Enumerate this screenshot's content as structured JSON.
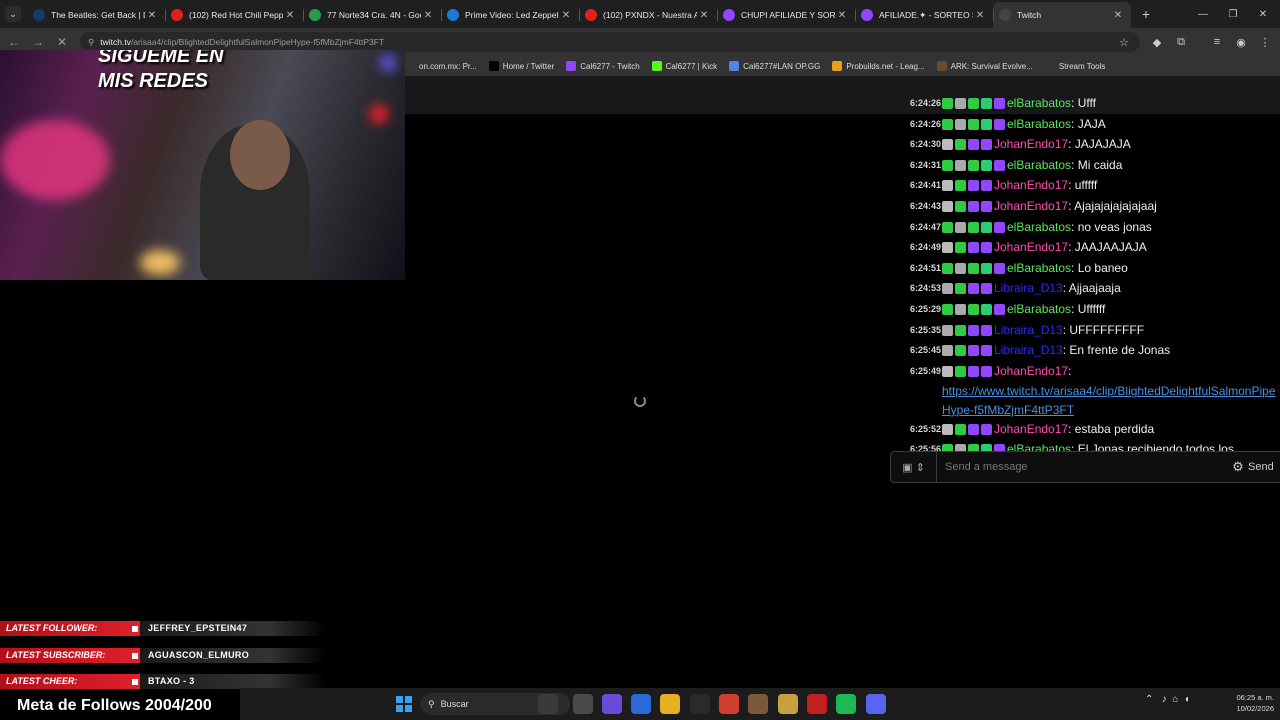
{
  "browser": {
    "tabs": [
      {
        "title": "The Beatles: Get Back | Di",
        "icon": "disney-icon",
        "color": "#1a3a6a"
      },
      {
        "title": "(102) Red Hot Chili Peppe",
        "icon": "youtube-icon",
        "color": "#e02020"
      },
      {
        "title": "77 Norte34 Cra. 4N - Goo",
        "icon": "maps-pin-icon",
        "color": "#2a9a4a"
      },
      {
        "title": "Prime Video: Led Zeppelin",
        "icon": "prime-video-icon",
        "color": "#1a7ad8"
      },
      {
        "title": "(102) PXNDX - Nuestra Af",
        "icon": "youtube-icon",
        "color": "#e02020"
      },
      {
        "title": "CHUPI AFILIADE Y SORTE",
        "icon": "twitch-icon",
        "color": "#9146ff"
      },
      {
        "title": "AFILIADE.✦ - SORTEO SKI",
        "icon": "twitch-icon",
        "color": "#9146ff"
      },
      {
        "title": "Twitch",
        "icon": "loading-icon",
        "color": "#444444",
        "active": true
      }
    ],
    "url_host": "twitch.tv",
    "url_path": "/arisaa4/clip/BlightedDelightfulSalmonPipeHype-f5fMbZjmF4ttP3FT",
    "bookmarks": [
      {
        "label": "on.com.mx: Pr...",
        "icon": "amazon-icon",
        "color": "#333333"
      },
      {
        "label": "Home / Twitter",
        "icon": "x-icon",
        "color": "#000000"
      },
      {
        "label": "Cal6277 - Twitch",
        "icon": "twitch-icon",
        "color": "#9146ff"
      },
      {
        "label": "Cal6277 | Kick",
        "icon": "kick-icon",
        "color": "#53fc18"
      },
      {
        "label": "Cal6277#LAN OP.GG",
        "icon": "opgg-icon",
        "color": "#5383e8"
      },
      {
        "label": "Probuilds.net - Leag...",
        "icon": "probuilds-icon",
        "color": "#e8a020"
      },
      {
        "label": "ARK: Survival Evolve...",
        "icon": "ark-icon",
        "color": "#6a4a2a"
      },
      {
        "label": "Stream Tools",
        "icon": "folder-icon",
        "color": "#333333"
      }
    ]
  },
  "webcam": {
    "overlay_line1": "SIGUEME EN",
    "overlay_line2": "MIS  REDES"
  },
  "chat": {
    "messages": [
      {
        "time": "6:24:26",
        "user": "elBarabatos",
        "color": "#5ce65c",
        "badges": [
          "#2ecc40",
          "#aaaaaa",
          "#2ecc40",
          "#2ecc71",
          "#9146ff"
        ],
        "text": "Ufff"
      },
      {
        "time": "6:24:26",
        "user": "elBarabatos",
        "color": "#5ce65c",
        "badges": [
          "#2ecc40",
          "#aaaaaa",
          "#2ecc40",
          "#2ecc71",
          "#9146ff"
        ],
        "text": "JAJA"
      },
      {
        "time": "6:24:30",
        "user": "JohanEndo17",
        "color": "#ff4fb4",
        "badges": [
          "#bbbbbb",
          "#2ecc40",
          "#9146ff",
          "#9146ff"
        ],
        "text": "JAJAJAJA"
      },
      {
        "time": "6:24:31",
        "user": "elBarabatos",
        "color": "#5ce65c",
        "badges": [
          "#2ecc40",
          "#aaaaaa",
          "#2ecc40",
          "#2ecc71",
          "#9146ff"
        ],
        "text": "Mi caida"
      },
      {
        "time": "6:24:41",
        "user": "JohanEndo17",
        "color": "#ff4fb4",
        "badges": [
          "#bbbbbb",
          "#2ecc40",
          "#9146ff",
          "#9146ff"
        ],
        "text": "ufffff"
      },
      {
        "time": "6:24:43",
        "user": "JohanEndo17",
        "color": "#ff4fb4",
        "badges": [
          "#bbbbbb",
          "#2ecc40",
          "#9146ff",
          "#9146ff"
        ],
        "text": "Ajajajajajajajaaj"
      },
      {
        "time": "6:24:47",
        "user": "elBarabatos",
        "color": "#5ce65c",
        "badges": [
          "#2ecc40",
          "#aaaaaa",
          "#2ecc40",
          "#2ecc71",
          "#9146ff"
        ],
        "text": "no veas jonas"
      },
      {
        "time": "6:24:49",
        "user": "JohanEndo17",
        "color": "#ff4fb4",
        "badges": [
          "#bbbbbb",
          "#2ecc40",
          "#9146ff",
          "#9146ff"
        ],
        "text": "JAAJAAJAJA"
      },
      {
        "time": "6:24:51",
        "user": "elBarabatos",
        "color": "#5ce65c",
        "badges": [
          "#2ecc40",
          "#aaaaaa",
          "#2ecc40",
          "#2ecc71",
          "#9146ff"
        ],
        "text": "Lo baneo"
      },
      {
        "time": "6:24:53",
        "user": "Libraira_D13",
        "color": "#2a2aff",
        "badges": [
          "#aaaaaa",
          "#2ecc40",
          "#9146ff",
          "#9146ff"
        ],
        "text": "Ajjaajaaja"
      },
      {
        "time": "6:25:29",
        "user": "elBarabatos",
        "color": "#5ce65c",
        "badges": [
          "#2ecc40",
          "#aaaaaa",
          "#2ecc40",
          "#2ecc71",
          "#9146ff"
        ],
        "text": "Uffffff"
      },
      {
        "time": "6:25:35",
        "user": "Libraira_D13",
        "color": "#2a2aff",
        "badges": [
          "#aaaaaa",
          "#2ecc40",
          "#9146ff",
          "#9146ff"
        ],
        "text": "UFFFFFFFFF"
      },
      {
        "time": "6:25:45",
        "user": "Libraira_D13",
        "color": "#2a2aff",
        "badges": [
          "#aaaaaa",
          "#2ecc40",
          "#9146ff",
          "#9146ff"
        ],
        "text": "En frente de Jonas"
      },
      {
        "time": "6:25:49",
        "user": "JohanEndo17",
        "color": "#ff4fb4",
        "badges": [
          "#bbbbbb",
          "#2ecc40",
          "#9146ff",
          "#9146ff"
        ],
        "text": "",
        "link": "https://www.twitch.tv/arisaa4/clip/BlightedDelightfulSalmonPipeHype-f5fMbZjmF4ttP3FT"
      },
      {
        "time": "6:25:52",
        "user": "JohanEndo17",
        "color": "#ff4fb4",
        "badges": [
          "#bbbbbb",
          "#2ecc40",
          "#9146ff",
          "#9146ff"
        ],
        "text": "estaba perdida"
      },
      {
        "time": "6:25:56",
        "user": "elBarabatos",
        "color": "#5ce65c",
        "badges": [
          "#2ecc40",
          "#aaaaaa",
          "#2ecc40",
          "#2ecc71",
          "#9146ff"
        ],
        "text": "El Jonas recibiendo todos los disparos"
      }
    ],
    "input_placeholder": "Send a message",
    "send_label": "Send"
  },
  "stream_overlay": {
    "rows": [
      {
        "label": "LATEST FOLLOWER:",
        "value": "JEFFREY_EPSTEIN47"
      },
      {
        "label": "LATEST SUBSCRIBER:",
        "value": "AGUASCON_ELMURO"
      },
      {
        "label": "LATEST CHEER:",
        "value": "BTAXO - 3"
      }
    ],
    "meta_label": "Meta de Follows",
    "meta_value": "2004/200"
  },
  "taskbar": {
    "search_label": "Buscar",
    "time": "06:25 a. m.",
    "date": "10/02/2026",
    "apps": [
      {
        "name": "taskview-icon",
        "color": "#3a3a3a"
      },
      {
        "name": "explorer-files-icon",
        "color": "#4a4a4a"
      },
      {
        "name": "copilot-icon",
        "color": "#6a4ad8"
      },
      {
        "name": "store-icon",
        "color": "#2a6ad8"
      },
      {
        "name": "folder-icon",
        "color": "#e8b020"
      },
      {
        "name": "steam-like-icon",
        "color": "#2a2a2a"
      },
      {
        "name": "chrome-icon",
        "color": "#d04030"
      },
      {
        "name": "game-icon",
        "color": "#7a5a3a"
      },
      {
        "name": "league-icon",
        "color": "#c8a040"
      },
      {
        "name": "red-app-icon",
        "color": "#c02020"
      },
      {
        "name": "spotify-icon",
        "color": "#1db954"
      },
      {
        "name": "discord-icon",
        "color": "#5865f2"
      }
    ]
  }
}
